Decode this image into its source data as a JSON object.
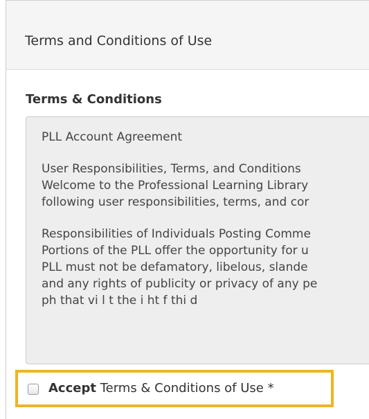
{
  "panel": {
    "title": "Terms and Conditions of Use"
  },
  "terms": {
    "label": "Terms & Conditions",
    "lines": [
      "PLL Account Agreement",
      "",
      "User Responsibilities, Terms, and Conditions",
      "Welcome to the Professional Learning Library",
      "following user responsibilities, terms, and cor",
      "",
      "Responsibilities of Individuals Posting Comme",
      "Portions of the PLL offer the opportunity for u",
      "PLL must not be defamatory, libelous, slande",
      "and any rights of publicity or privacy of any pe",
      "ph              that vi l t  the  i ht  f    thi d"
    ]
  },
  "accept": {
    "strong": "Accept",
    "rest": " Terms & Conditions of Use *",
    "checked": false
  },
  "colors": {
    "highlight_border": "#f0b323",
    "heading_bg": "#f5f5f5",
    "terms_bg": "#eeeeee"
  }
}
